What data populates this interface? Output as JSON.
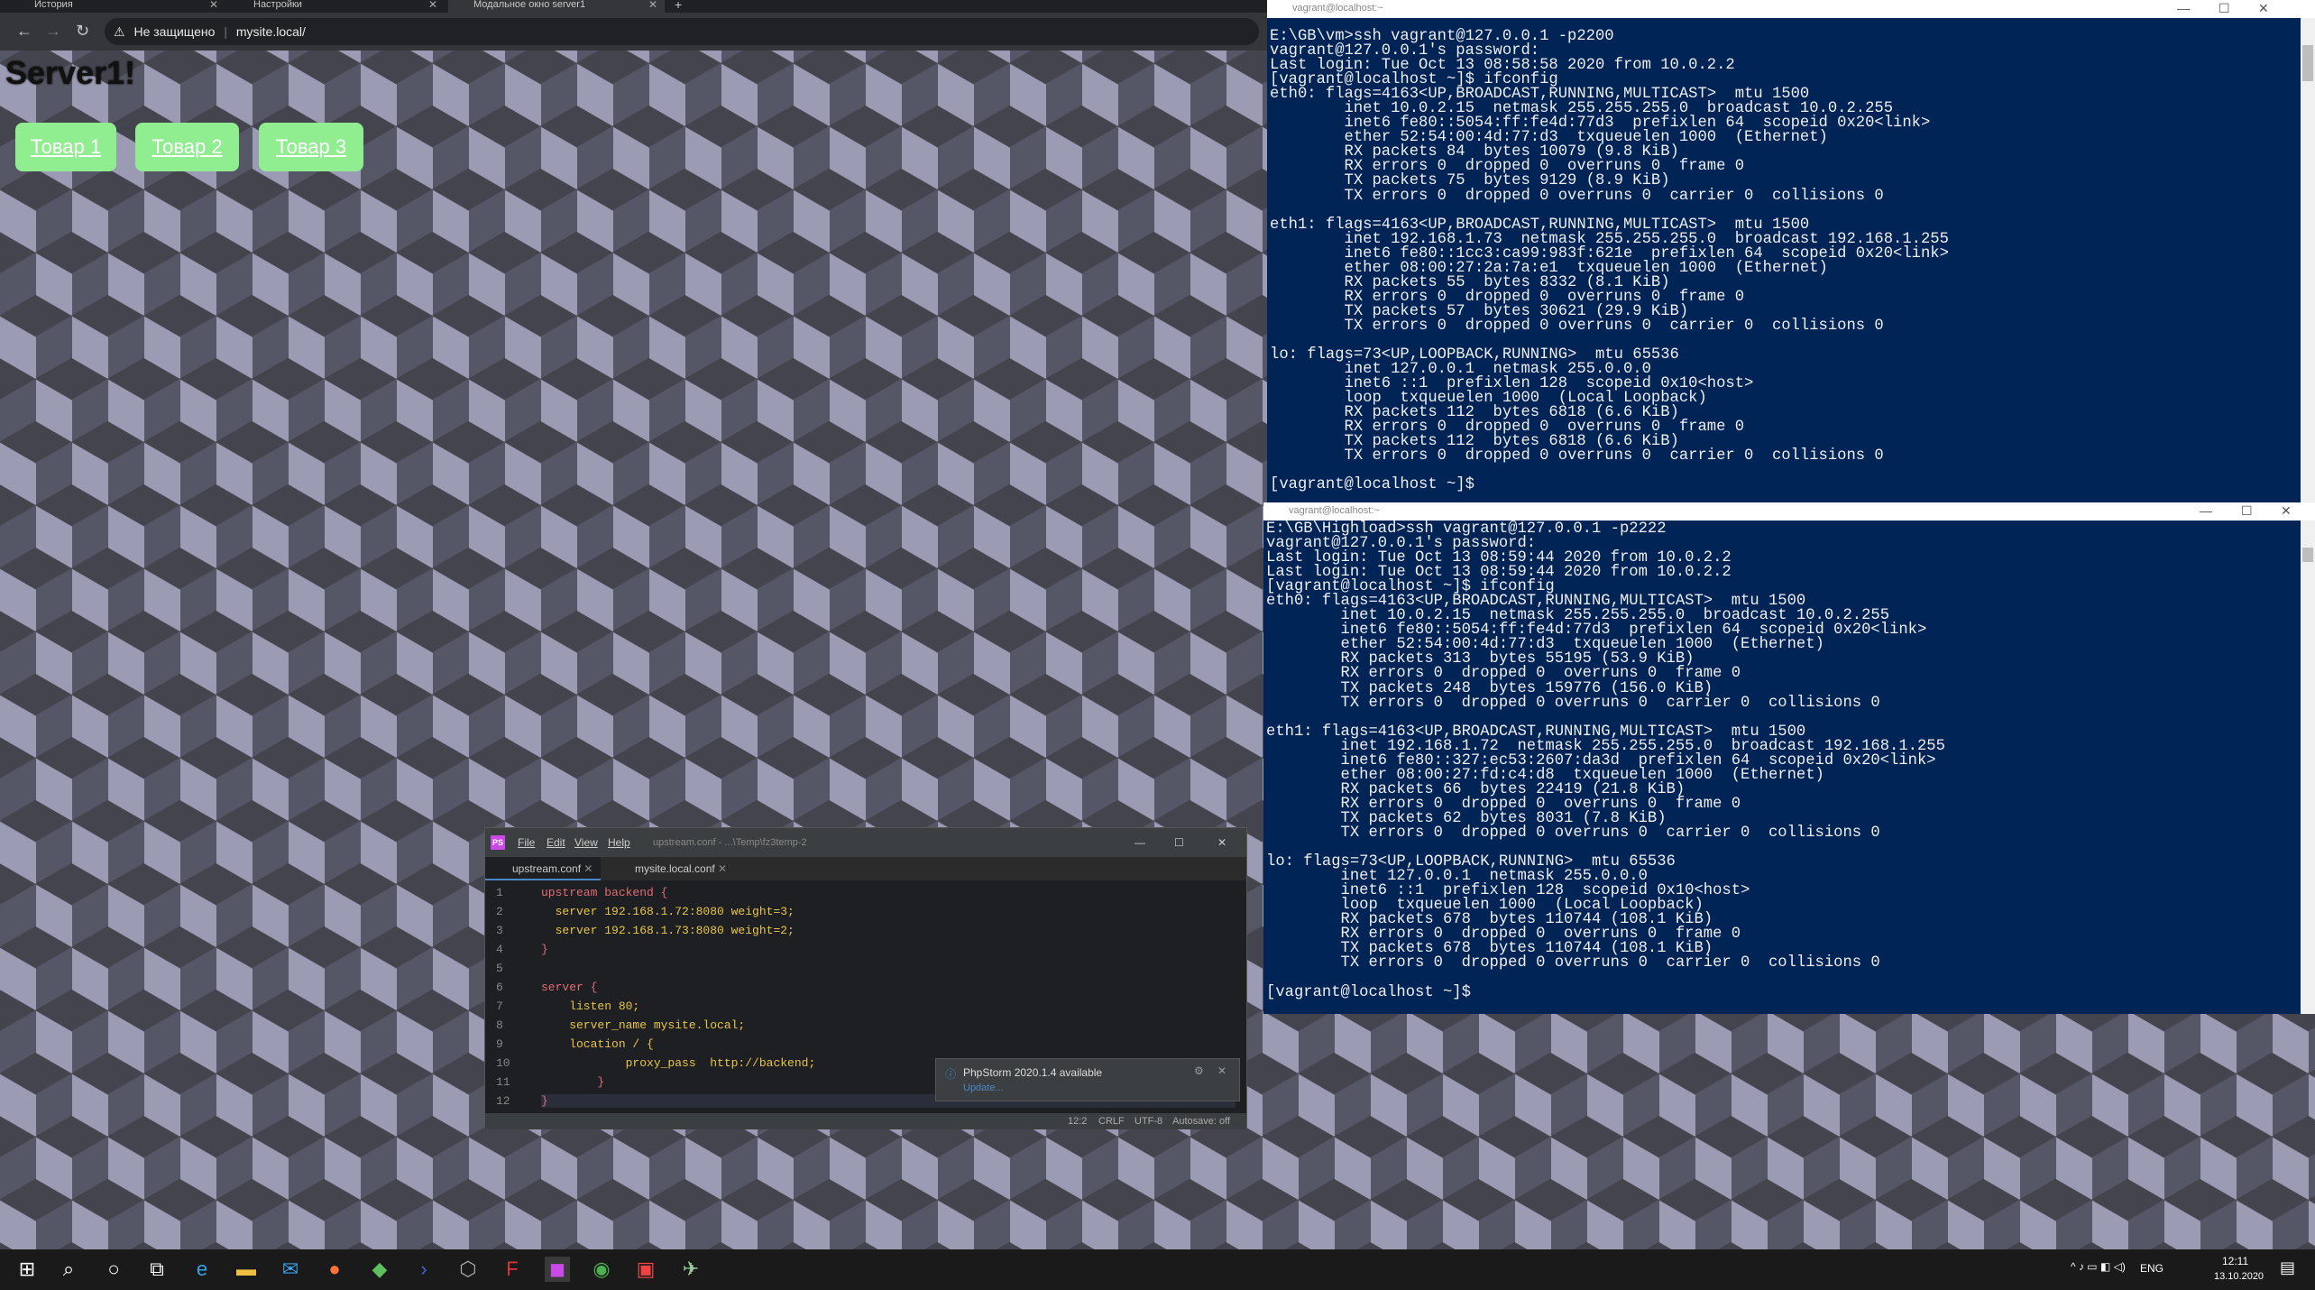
{
  "browser": {
    "tabs": [
      {
        "label": "История"
      },
      {
        "label": "Настройки"
      },
      {
        "label": "Модальное окно server1"
      }
    ],
    "new_tab": "+",
    "close": "✕",
    "security": "Не защищено",
    "url": "mysite.local/",
    "heading": "Server1!",
    "products": [
      "Товар 1",
      "Товар 2",
      "Товар 3"
    ]
  },
  "term1": {
    "title": "vagrant@localhost:~",
    "text": "E:\\GB\\vm>ssh vagrant@127.0.0.1 -p2200\nvagrant@127.0.0.1's password:\nLast login: Tue Oct 13 08:58:58 2020 from 10.0.2.2\n[vagrant@localhost ~]$ ifconfig\neth0: flags=4163<UP,BROADCAST,RUNNING,MULTICAST>  mtu 1500\n        inet 10.0.2.15  netmask 255.255.255.0  broadcast 10.0.2.255\n        inet6 fe80::5054:ff:fe4d:77d3  prefixlen 64  scopeid 0x20<link>\n        ether 52:54:00:4d:77:d3  txqueuelen 1000  (Ethernet)\n        RX packets 84  bytes 10079 (9.8 KiB)\n        RX errors 0  dropped 0  overruns 0  frame 0\n        TX packets 75  bytes 9129 (8.9 KiB)\n        TX errors 0  dropped 0 overruns 0  carrier 0  collisions 0\n\neth1: flags=4163<UP,BROADCAST,RUNNING,MULTICAST>  mtu 1500\n        inet 192.168.1.73  netmask 255.255.255.0  broadcast 192.168.1.255\n        inet6 fe80::1cc3:ca99:983f:621e  prefixlen 64  scopeid 0x20<link>\n        ether 08:00:27:2a:7a:e1  txqueuelen 1000  (Ethernet)\n        RX packets 55  bytes 8332 (8.1 KiB)\n        RX errors 0  dropped 0  overruns 0  frame 0\n        TX packets 57  bytes 30621 (29.9 KiB)\n        TX errors 0  dropped 0 overruns 0  carrier 0  collisions 0\n\nlo: flags=73<UP,LOOPBACK,RUNNING>  mtu 65536\n        inet 127.0.0.1  netmask 255.0.0.0\n        inet6 ::1  prefixlen 128  scopeid 0x10<host>\n        loop  txqueuelen 1000  (Local Loopback)\n        RX packets 112  bytes 6818 (6.6 KiB)\n        RX errors 0  dropped 0  overruns 0  frame 0\n        TX packets 112  bytes 6818 (6.6 KiB)\n        TX errors 0  dropped 0 overruns 0  carrier 0  collisions 0\n\n[vagrant@localhost ~]$"
  },
  "term2": {
    "title": "vagrant@localhost:~",
    "text": "E:\\GB\\Highload>ssh vagrant@127.0.0.1 -p2222\nvagrant@127.0.0.1's password:\nLast login: Tue Oct 13 08:59:44 2020 from 10.0.2.2\nLast login: Tue Oct 13 08:59:44 2020 from 10.0.2.2\n[vagrant@localhost ~]$ ifconfig\neth0: flags=4163<UP,BROADCAST,RUNNING,MULTICAST>  mtu 1500\n        inet 10.0.2.15  netmask 255.255.255.0  broadcast 10.0.2.255\n        inet6 fe80::5054:ff:fe4d:77d3  prefixlen 64  scopeid 0x20<link>\n        ether 52:54:00:4d:77:d3  txqueuelen 1000  (Ethernet)\n        RX packets 313  bytes 55195 (53.9 KiB)\n        RX errors 0  dropped 0  overruns 0  frame 0\n        TX packets 248  bytes 159776 (156.0 KiB)\n        TX errors 0  dropped 0 overruns 0  carrier 0  collisions 0\n\neth1: flags=4163<UP,BROADCAST,RUNNING,MULTICAST>  mtu 1500\n        inet 192.168.1.72  netmask 255.255.255.0  broadcast 192.168.1.255\n        inet6 fe80::327:ec53:2607:da3d  prefixlen 64  scopeid 0x20<link>\n        ether 08:00:27:fd:c4:d8  txqueuelen 1000  (Ethernet)\n        RX packets 66  bytes 22419 (21.8 KiB)\n        RX errors 0  dropped 0  overruns 0  frame 0\n        TX packets 62  bytes 8031 (7.8 KiB)\n        TX errors 0  dropped 0 overruns 0  carrier 0  collisions 0\n\nlo: flags=73<UP,LOOPBACK,RUNNING>  mtu 65536\n        inet 127.0.0.1  netmask 255.0.0.0\n        inet6 ::1  prefixlen 128  scopeid 0x10<host>\n        loop  txqueuelen 1000  (Local Loopback)\n        RX packets 678  bytes 110744 (108.1 KiB)\n        RX errors 0  dropped 0  overruns 0  frame 0\n        TX packets 678  bytes 110744 (108.1 KiB)\n        TX errors 0  dropped 0 overruns 0  carrier 0  collisions 0\n\n[vagrant@localhost ~]$"
  },
  "window_controls": {
    "minimize": "—",
    "maximize": "☐",
    "close": "✕"
  },
  "ide": {
    "logo": "PS",
    "menu": [
      "File",
      "Edit",
      "View",
      "Help"
    ],
    "title": "upstream.conf - ...\\Temp\\fz3temp-2",
    "tabs": [
      "upstream.conf",
      "mysite.local.conf"
    ],
    "line_numbers": [
      "1",
      "2",
      "3",
      "4",
      "5",
      "6",
      "7",
      "8",
      "9",
      "10",
      "11",
      "12"
    ],
    "code": [
      "upstream backend {",
      "  server 192.168.1.72:8080 weight=3;",
      "  server 192.168.1.73:8080 weight=2;",
      "}",
      "",
      "server {",
      "    listen 80;",
      "    server_name mysite.local;",
      "    location / {",
      "            proxy_pass  http://backend;",
      "        }",
      "}"
    ],
    "status": {
      "pos": "12:2",
      "eol": "CRLF",
      "enc": "UTF-8",
      "autosave": "Autosave: off"
    },
    "notification": {
      "title": "PhpStorm 2020.1.4 available",
      "link": "Update..."
    }
  },
  "taskbar": {
    "icons": [
      "windows-icon",
      "search-icon",
      "cortana-icon",
      "task-view-icon",
      "edge-icon",
      "explorer-icon",
      "mail-icon",
      "firefox-icon",
      "git-icon",
      "powershell-icon",
      "virtualbox-icon",
      "filezilla-icon",
      "phpstorm-icon",
      "chrome-icon",
      "app-icon",
      "app2-icon"
    ],
    "lang": "ENG",
    "time": "12:11",
    "date": "13.10.2020"
  }
}
